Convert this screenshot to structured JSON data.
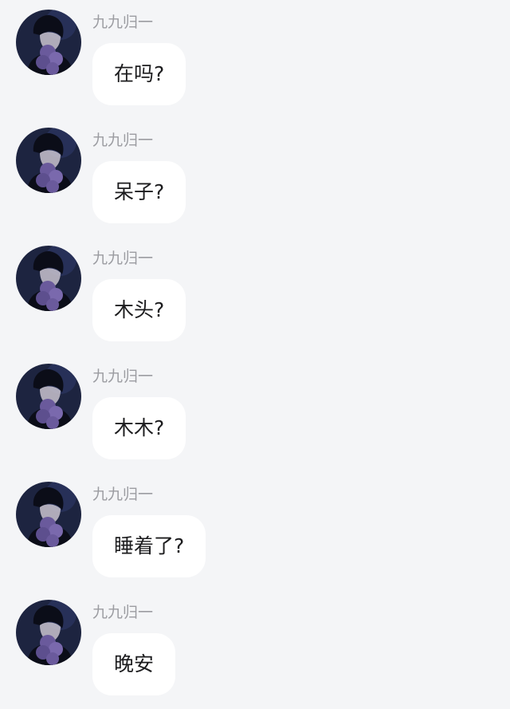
{
  "messages": [
    {
      "sender": "九九归一",
      "text": "在吗?",
      "avatar_icon": "profile-avatar-icon"
    },
    {
      "sender": "九九归一",
      "text": "呆子?",
      "avatar_icon": "profile-avatar-icon"
    },
    {
      "sender": "九九归一",
      "text": "木头?",
      "avatar_icon": "profile-avatar-icon"
    },
    {
      "sender": "九九归一",
      "text": "木木?",
      "avatar_icon": "profile-avatar-icon"
    },
    {
      "sender": "九九归一",
      "text": "睡着了?",
      "avatar_icon": "profile-avatar-icon"
    },
    {
      "sender": "九九归一",
      "text": "晚安",
      "avatar_icon": "profile-avatar-icon"
    }
  ],
  "colors": {
    "background": "#f4f5f7",
    "bubble": "#ffffff",
    "sender_name": "#9b9ca1",
    "message_text": "#1c1c1e",
    "avatar_dark": "#1d2440",
    "avatar_flower": "#6a5a9c"
  }
}
